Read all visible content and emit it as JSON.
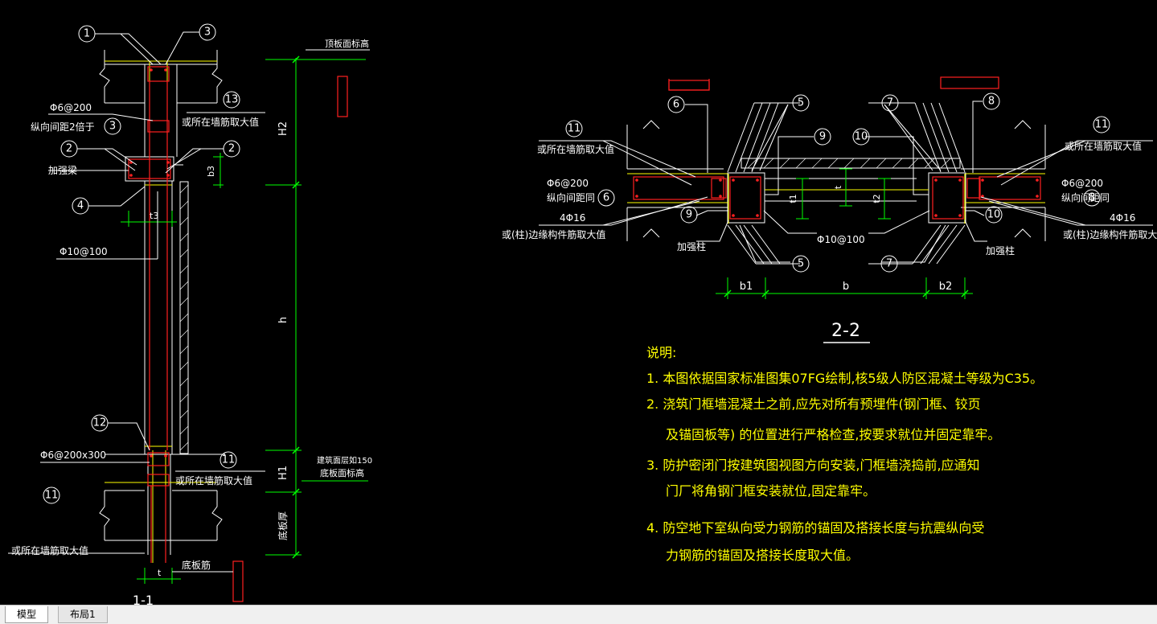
{
  "section_1_1": {
    "title": "1-1",
    "circles": {
      "c1": "1",
      "c3": "3",
      "c13": "13",
      "c3b": "3",
      "c2l": "2",
      "c2r": "2",
      "c4": "4",
      "c12": "12",
      "c11r": "11",
      "c11l": "11"
    },
    "labels": {
      "phi6_200": "Φ6@200",
      "long_spacing": "纵向间距2倍于",
      "add_beam": "加强梁",
      "or_max_top": "或所在墙筋取大值",
      "phi10_100": "Φ10@100",
      "phi6_200x300": "Φ6@200x300",
      "or_max_bot": "或所在墙筋取大值",
      "or_max_left": "或所在墙筋取大值",
      "bottom_bar": "底板筋",
      "top_elev": "顶板面标高",
      "floor_elev_note": "建筑面层如150",
      "bottom_elev": "底板面标高",
      "bottom_thk": "底板厚",
      "dim_h2": "H2",
      "dim_h": "h",
      "dim_h1": "H1",
      "dim_b3": "b3",
      "dim_t3": "t3",
      "dim_t": "t"
    }
  },
  "section_2_2": {
    "title": "2-2",
    "circles": {
      "c6": "6",
      "c5t": "5",
      "c7t": "7",
      "c8": "8",
      "c11l": "11",
      "c9t": "9",
      "c10t": "10",
      "c11r": "11",
      "c9b": "9",
      "c10b": "10",
      "c5b": "5",
      "c7b": "7",
      "c6m": "6",
      "c8m": "8"
    },
    "labels": {
      "or_max_l": "或所在墙筋取大值",
      "phi6_200_l": "Φ6@200",
      "long_same_l": "纵向间距同",
      "four_phi16_l": "4Φ16",
      "or_edge_l": "或(柱)边缘构件筋取大值",
      "add_col_l": "加强柱",
      "or_max_r": "或所在墙筋取大值",
      "phi6_200_r": "Φ6@200",
      "long_same_r": "纵向间距同",
      "four_phi16_r": "4Φ16",
      "or_edge_r": "或(柱)边缘构件筋取大值",
      "add_col_r": "加强柱",
      "phi10_100": "Φ10@100",
      "dim_t1": "t1",
      "dim_t": "t",
      "dim_t2": "t2",
      "dim_b1": "b1",
      "dim_b": "b",
      "dim_b2": "b2"
    }
  },
  "notes": {
    "title": "说明:",
    "n1": "1.  本图依据国家标准图集07FG绘制,核5级人防区混凝土等级为C35。",
    "n2a": "2.  浇筑门框墙混凝土之前,应先对所有预埋件(钢门框、铰页",
    "n2b": "及锚固板等)       的位置进行严格检查,按要求就位并固定靠牢。",
    "n3a": "3.  防护密闭门按建筑图视图方向安装,门框墙浇捣前,应通知",
    "n3b": "门厂将角钢门框安装就位,固定靠牢。",
    "n4a": "4.  防空地下室纵向受力钢筋的锚固及搭接长度与抗震纵向受",
    "n4b": "力钢筋的锚固及搭接长度取大值。"
  },
  "tabs": {
    "model": "模型",
    "layout1": "布局1"
  },
  "colors": {
    "background": "#000000",
    "wall_lines": "#ffffff",
    "dimension": "#00ff00",
    "rebar": "#ff0000",
    "notes_text": "#ffff00",
    "leader": "#ffffff"
  }
}
